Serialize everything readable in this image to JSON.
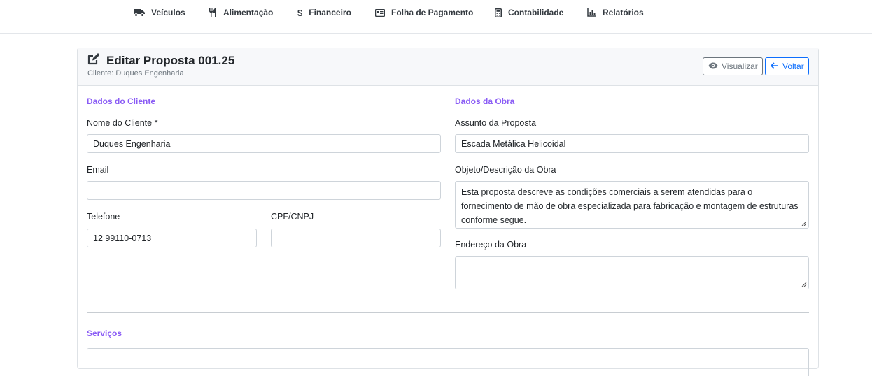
{
  "nav": {
    "items": [
      {
        "label": "Veículos",
        "icon": "truck-icon"
      },
      {
        "label": "Alimentação",
        "icon": "utensils-icon"
      },
      {
        "label": "Financeiro",
        "icon": "dollar-icon"
      },
      {
        "label": "Folha de Pagamento",
        "icon": "id-card-icon"
      },
      {
        "label": "Contabilidade",
        "icon": "calculator-icon"
      },
      {
        "label": "Relatórios",
        "icon": "chart-icon"
      }
    ]
  },
  "header": {
    "title": "Editar Proposta 001.25",
    "subtitle": "Cliente: Duques Engenharia",
    "view_label": "Visualizar",
    "back_label": "Voltar"
  },
  "cliente": {
    "section_title": "Dados do Cliente",
    "nome_label": "Nome do Cliente *",
    "nome_value": "Duques Engenharia",
    "email_label": "Email",
    "email_value": "",
    "telefone_label": "Telefone",
    "telefone_value": "12 99110-0713",
    "cpf_label": "CPF/CNPJ",
    "cpf_value": ""
  },
  "obra": {
    "section_title": "Dados da Obra",
    "assunto_label": "Assunto da Proposta",
    "assunto_value": "Escada Metálica Helicoidal",
    "descricao_label": "Objeto/Descrição da Obra",
    "descricao_value": "Esta proposta descreve as condições comerciais a serem atendidas para o fornecimento de mão de obra especializada para fabricação e montagem de estruturas conforme segue.",
    "endereco_label": "Endereço da Obra",
    "endereco_value": ""
  },
  "servicos": {
    "section_title": "Serviços"
  },
  "colors": {
    "accent": "#8a5cf5",
    "primary": "#0d6efd",
    "secondary": "#6c757d"
  }
}
